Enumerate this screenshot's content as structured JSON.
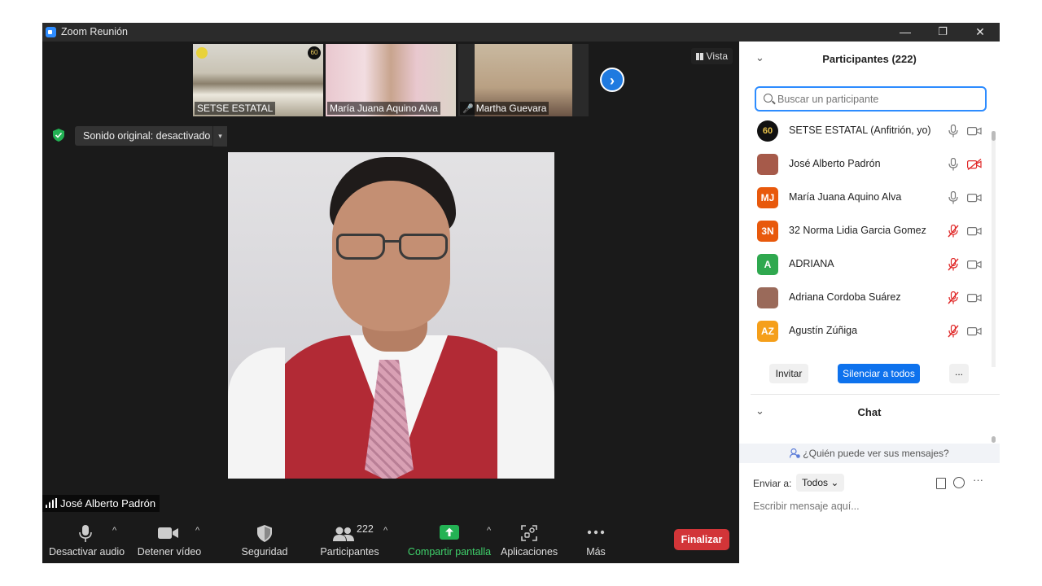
{
  "window": {
    "title": "Zoom Reunión",
    "controls": {
      "minimize": "—",
      "restore": "❐",
      "close": "✕"
    }
  },
  "stage": {
    "thumbnails": [
      {
        "name": "SETSE ESTATAL",
        "muted": false
      },
      {
        "name": "María Juana Aquino Alva",
        "muted": false
      },
      {
        "name": "Martha Guevara",
        "muted": true
      }
    ],
    "thumb_badge": "60",
    "next_page_icon": "›",
    "view_label": "Vista",
    "original_sound_label": "Sonido original: desactivado",
    "original_sound_dropdown": "▾",
    "active_speaker": "José Alberto Padrón"
  },
  "toolbar": {
    "audio_label": "Desactivar audio",
    "video_label": "Detener vídeo",
    "security_label": "Seguridad",
    "participants_label": "Participantes",
    "participants_count": "222",
    "share_label": "Compartir pantalla",
    "apps_label": "Aplicaciones",
    "more_label": "Más",
    "end_label": "Finalizar",
    "caret": "^"
  },
  "participants_panel": {
    "collapse_icon": "⌄",
    "title": "Participantes (222)",
    "search_placeholder": "Buscar un participante",
    "items": [
      {
        "name": "SETSE ESTATAL (Anfitrión, yo)",
        "avatar": "60",
        "avatar_color": "#111111",
        "mic_muted": false,
        "video_off": false
      },
      {
        "name": "José Alberto Padrón",
        "avatar": "",
        "avatar_color": "#a65a4a",
        "mic_muted": false,
        "video_off": true
      },
      {
        "name": "María Juana Aquino Alva",
        "avatar": "MJ",
        "avatar_color": "#e8590c",
        "mic_muted": false,
        "video_off": false
      },
      {
        "name": "32 Norma Lidia Garcia Gomez",
        "avatar": "3N",
        "avatar_color": "#e8590c",
        "mic_muted": true,
        "video_off": false
      },
      {
        "name": "ADRIANA",
        "avatar": "A",
        "avatar_color": "#2fa84f",
        "mic_muted": true,
        "video_off": false
      },
      {
        "name": "Adriana Cordoba Suárez",
        "avatar": "",
        "avatar_color": "#9a6a5a",
        "mic_muted": true,
        "video_off": false
      },
      {
        "name": "Agustín Zúñiga",
        "avatar": "AZ",
        "avatar_color": "#f59f1a",
        "mic_muted": true,
        "video_off": false
      }
    ],
    "invite_label": "Invitar",
    "mute_all_label": "Silenciar a todos",
    "more_label": "..."
  },
  "chat_panel": {
    "collapse_icon": "⌄",
    "title": "Chat",
    "who_can_see": "¿Quién puede ver sus mensajes?",
    "send_to_label": "Enviar a:",
    "send_to_value": "Todos",
    "send_to_caret": "⌄",
    "more_icon": "···",
    "input_placeholder": "Escribir mensaje aquí..."
  },
  "colors": {
    "accent": "#0e72ed",
    "end_button": "#d23538",
    "share_green": "#3fd16b",
    "muted_red": "#e02828"
  }
}
